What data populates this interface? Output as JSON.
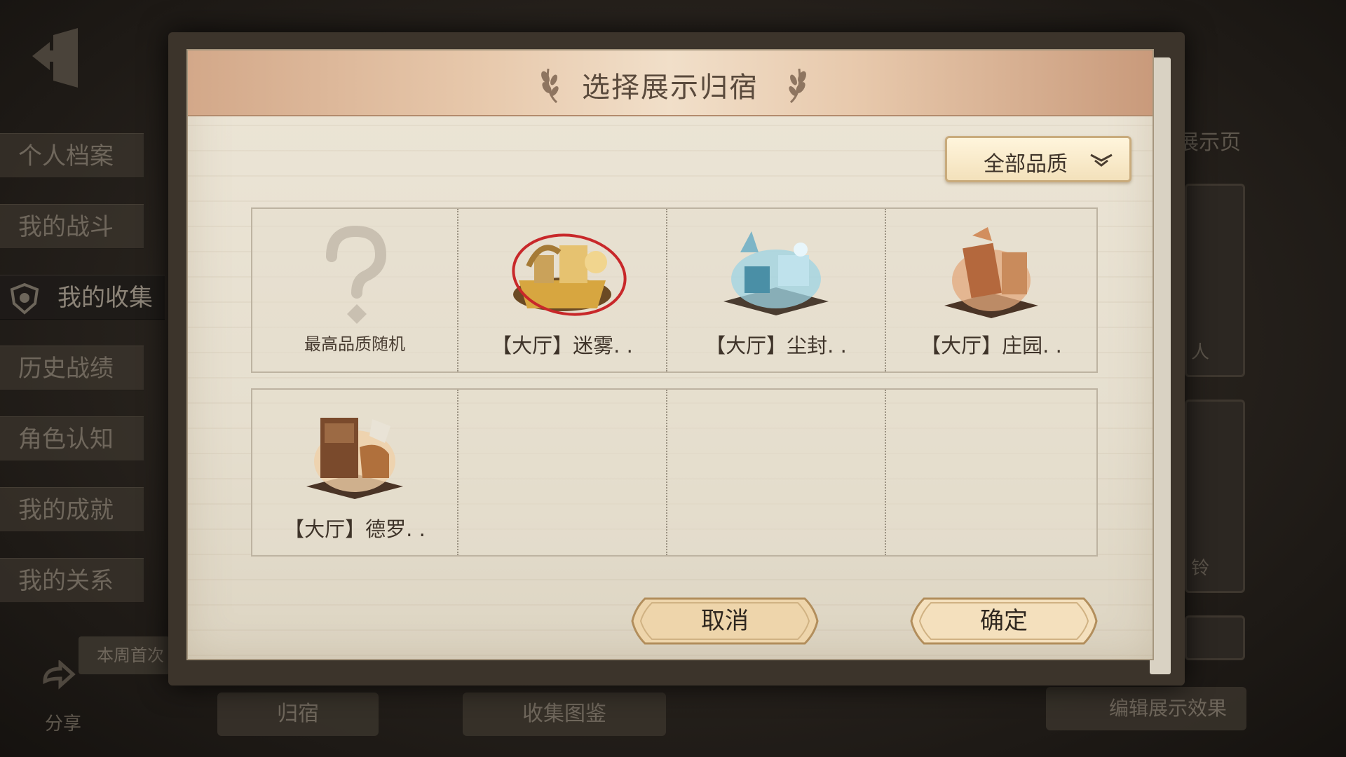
{
  "sidebar": {
    "items": [
      {
        "label": "个人档案"
      },
      {
        "label": "我的战斗"
      },
      {
        "label": "我的收集",
        "active": true
      },
      {
        "label": "历史战绩"
      },
      {
        "label": "角色认知"
      },
      {
        "label": "我的成就"
      },
      {
        "label": "我的关系"
      }
    ],
    "weekly_label": "本周首次",
    "share_label": "分享"
  },
  "background": {
    "bottom_tabs": [
      "归宿",
      "收集图鉴"
    ],
    "right_title": "展示页",
    "right_cards": [
      "人",
      "铃"
    ],
    "edit_label": "编辑展示效果"
  },
  "dialog": {
    "title": "选择展示归宿",
    "quality_filter": "全部品质",
    "items": [
      {
        "label": "最高品质随机",
        "icon": "question-mark-icon"
      },
      {
        "label": "【大厅】迷雾. .",
        "icon": "misty-lobby-icon",
        "circled": true
      },
      {
        "label": "【大厅】尘封. .",
        "icon": "dusty-lobby-icon"
      },
      {
        "label": "【大厅】庄园. .",
        "icon": "manor-lobby-icon"
      },
      {
        "label": "【大厅】德罗. .",
        "icon": "dero-lobby-icon"
      }
    ],
    "cancel_label": "取消",
    "confirm_label": "确定"
  },
  "colors": {
    "paper": "#e8e1d2",
    "header": "#e7c8ab",
    "button": "#f0d9b2",
    "highlight_circle": "#c8282a"
  }
}
